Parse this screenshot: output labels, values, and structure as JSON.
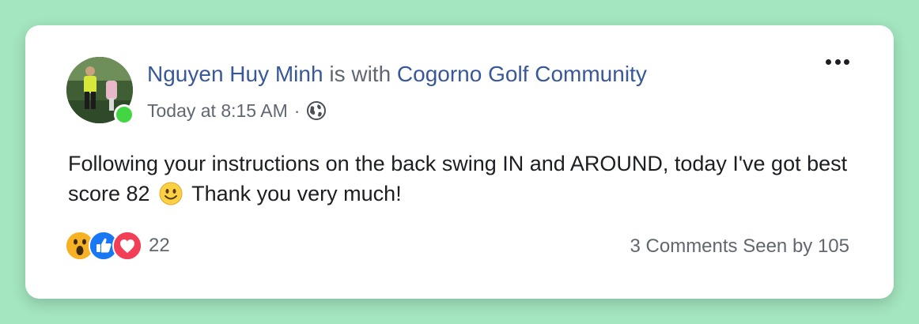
{
  "post": {
    "author": "Nguyen Huy Minh",
    "with_text": "is with",
    "group": "Cogorno Golf Community",
    "time": "Today at 8:15 AM",
    "separator": "·",
    "privacy_icon": "globe-icon",
    "text_before_emoji": "Following your instructions on the back swing IN and AROUND, today I've got best score 82",
    "emoji": "smiling-face-icon",
    "text_after_emoji": "Thank you very much!",
    "reactions": [
      "wow-icon",
      "like-icon",
      "love-icon"
    ],
    "reaction_count": "22",
    "comments": "3 Comments",
    "seen_by": "Seen by 105"
  },
  "colors": {
    "background": "#a3e6bf",
    "link": "#385898",
    "secondary_text": "#616770",
    "online": "#42d742",
    "like": "#1877f2",
    "love": "#f33e58",
    "wow": "#f7b125"
  }
}
